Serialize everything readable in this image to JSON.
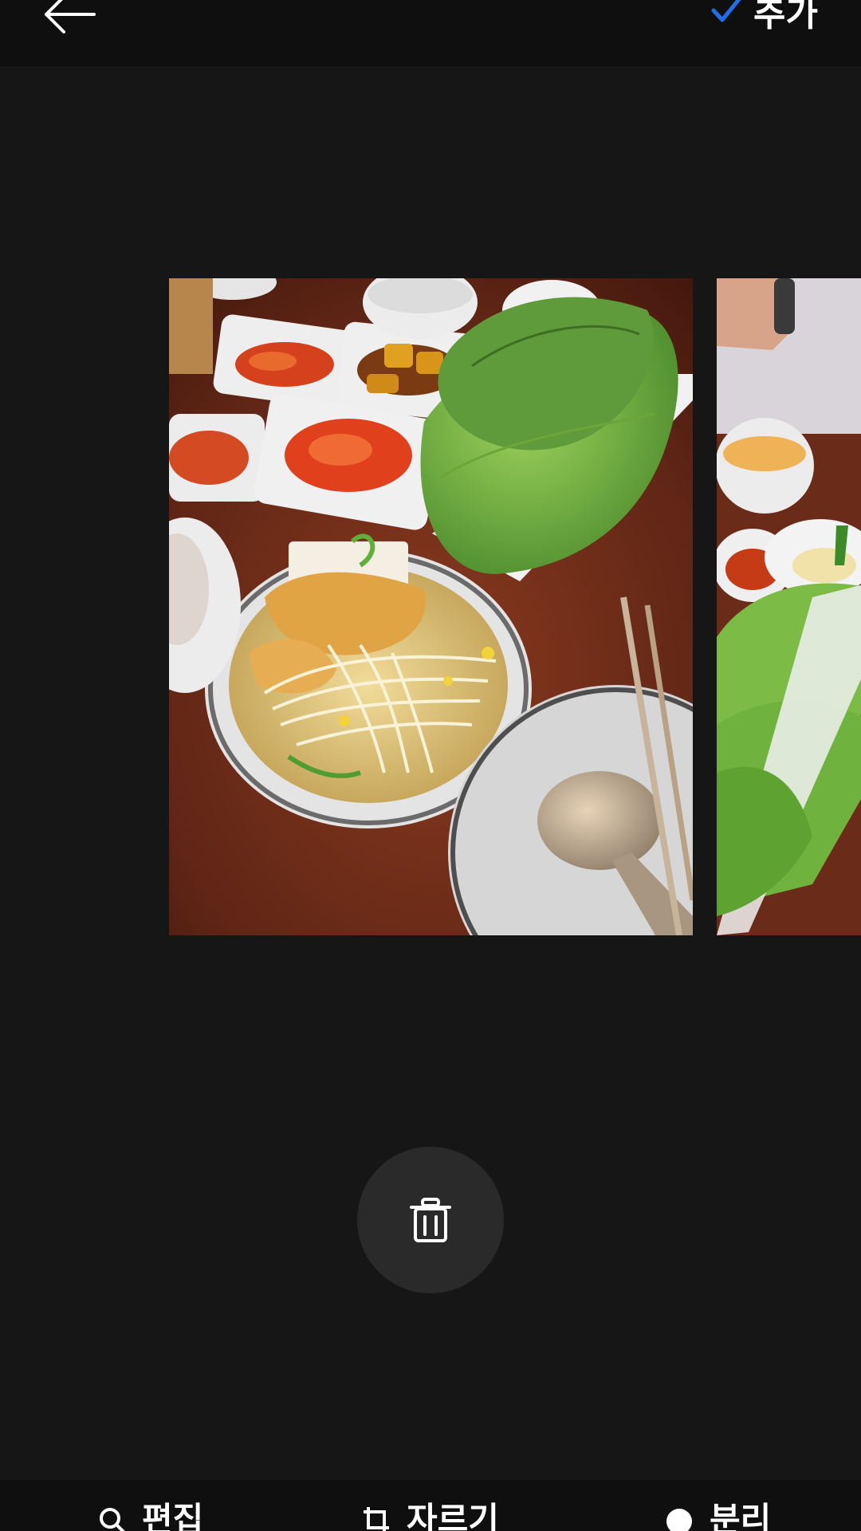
{
  "header": {
    "back_icon": "arrow-left-icon",
    "add_label": "추가",
    "add_icon": "checkmark-icon",
    "accent": "#1e6fe8"
  },
  "photos": [
    {
      "label": "",
      "state": "selected"
    },
    {
      "label": "",
      "state": "next"
    }
  ],
  "actions": {
    "delete_icon": "trash-icon"
  },
  "bottom_tools": [
    {
      "label": "편집",
      "icon": "search-edit-icon"
    },
    {
      "label": "자르기",
      "icon": "crop-icon"
    },
    {
      "label": "분리",
      "icon": "split-icon"
    }
  ]
}
